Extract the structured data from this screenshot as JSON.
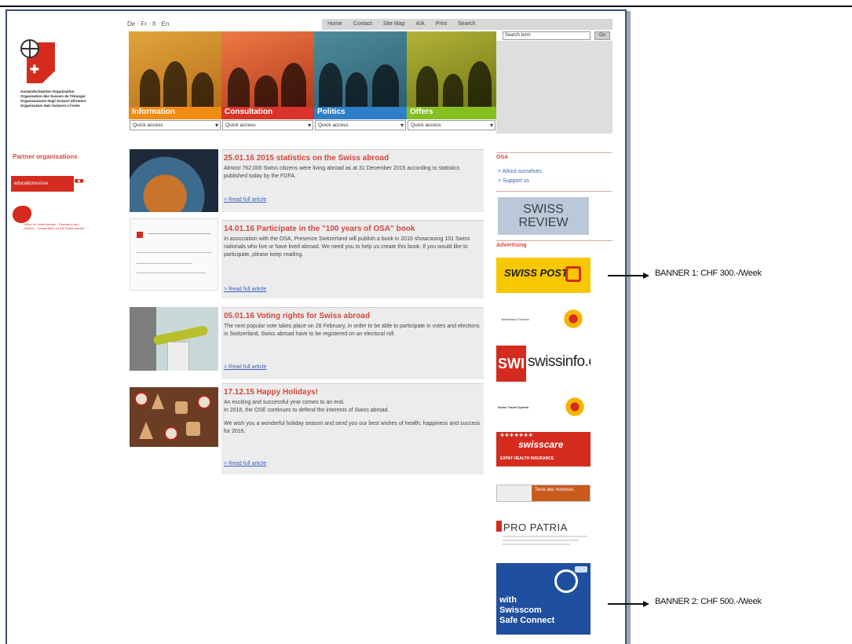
{
  "languages": "De · Fr · It · En",
  "top_nav": [
    "Home",
    "Contact",
    "Site Map",
    "A/A",
    "Print",
    "Search"
  ],
  "search": {
    "placeholder": "Search term",
    "button": "Go"
  },
  "logo_lines": [
    "Auslandschweizer-Organisation",
    "Organisation des Suisses de l'étranger",
    "Organizzazione degli Svizzeri all'estero",
    "Organisaziun dals Svizzers a l'ester"
  ],
  "categories": [
    {
      "label": "Information",
      "color": "#ef8b12",
      "quick_access": "Quick access"
    },
    {
      "label": "Consultation",
      "color": "#d9332a",
      "quick_access": "Quick access"
    },
    {
      "label": "Politics",
      "color": "#2e7fc8",
      "quick_access": "Quick access"
    },
    {
      "label": "Offers",
      "color": "#87bf22",
      "quick_access": "Quick access"
    }
  ],
  "partner_organisations": {
    "title": "Partner organisations",
    "educationsuisse": "educationsuisse",
    "osa_text": "Office for Swiss Abroad · Education and children · Cooperation for the Swiss abroad"
  },
  "articles": [
    {
      "title": "25.01.16 2015 statistics on the Swiss abroad",
      "paras": [
        "Almost 762,000 Swiss citizens were living abroad as at 31 December 2015 according to statistics published today by the FDFA."
      ],
      "link": "> Read full article"
    },
    {
      "title": "14.01.16 Participate in the \"100 years of OSA\" book",
      "paras": [
        "In association with the OSA, Presence Switzerland will publish a book in 2016 showcasing 101 Swiss nationals who live or have lived abroad. We need you to help us create this book. If you would like to participate, please keep reading."
      ],
      "link": "> Read full article"
    },
    {
      "title": "05.01.16 Voting rights for Swiss abroad",
      "paras": [
        "The next popular vote takes place on 28 February, in order to be able to participate in votes and elections in Switzerland, Swiss abroad have to be registered on an electoral roll."
      ],
      "link": "> Read full article"
    },
    {
      "title": "17.12.15 Happy Holidays!",
      "paras": [
        "An exciting and successful year comes to an end.",
        "In 2016, the OSE continues to defend the interests of Swiss abroad.",
        "We wish you a wonderful holiday season and send you our best wishes of health, happiness and success for 2016."
      ],
      "link": "> Read full article"
    }
  ],
  "sidebar": {
    "osa_heading": "OSA",
    "links": [
      "> About ourselves",
      "> Support us"
    ],
    "review_lines": [
      "SWISS",
      "REVIEW"
    ],
    "advertising_heading": "Advertising"
  },
  "ads": {
    "swiss_post": "SWISS POST",
    "switzerland_tourism": "Switzerland Tourism",
    "swi": "SWI",
    "swissinfo": "swissinfo.ch",
    "swiss_travel_system": "Swiss Travel System",
    "swisscare": "swisscare",
    "swisscare_sub": "EXPAT HEALTH INSURANCE",
    "terre_des_hommes": "Terre des hommes",
    "pro_patria": "PRO PATRIA",
    "swisscom_lines": [
      "with",
      "Swisscom",
      "Safe Connect"
    ]
  },
  "annotations": {
    "banner1": "BANNER 1: CHF 300.-/Week",
    "banner2": "BANNER 2: CHF 500.-/Week"
  },
  "colors": {
    "accent_red": "#d3473d",
    "link_blue": "#3a63b8",
    "article_bg": "#ececec"
  }
}
